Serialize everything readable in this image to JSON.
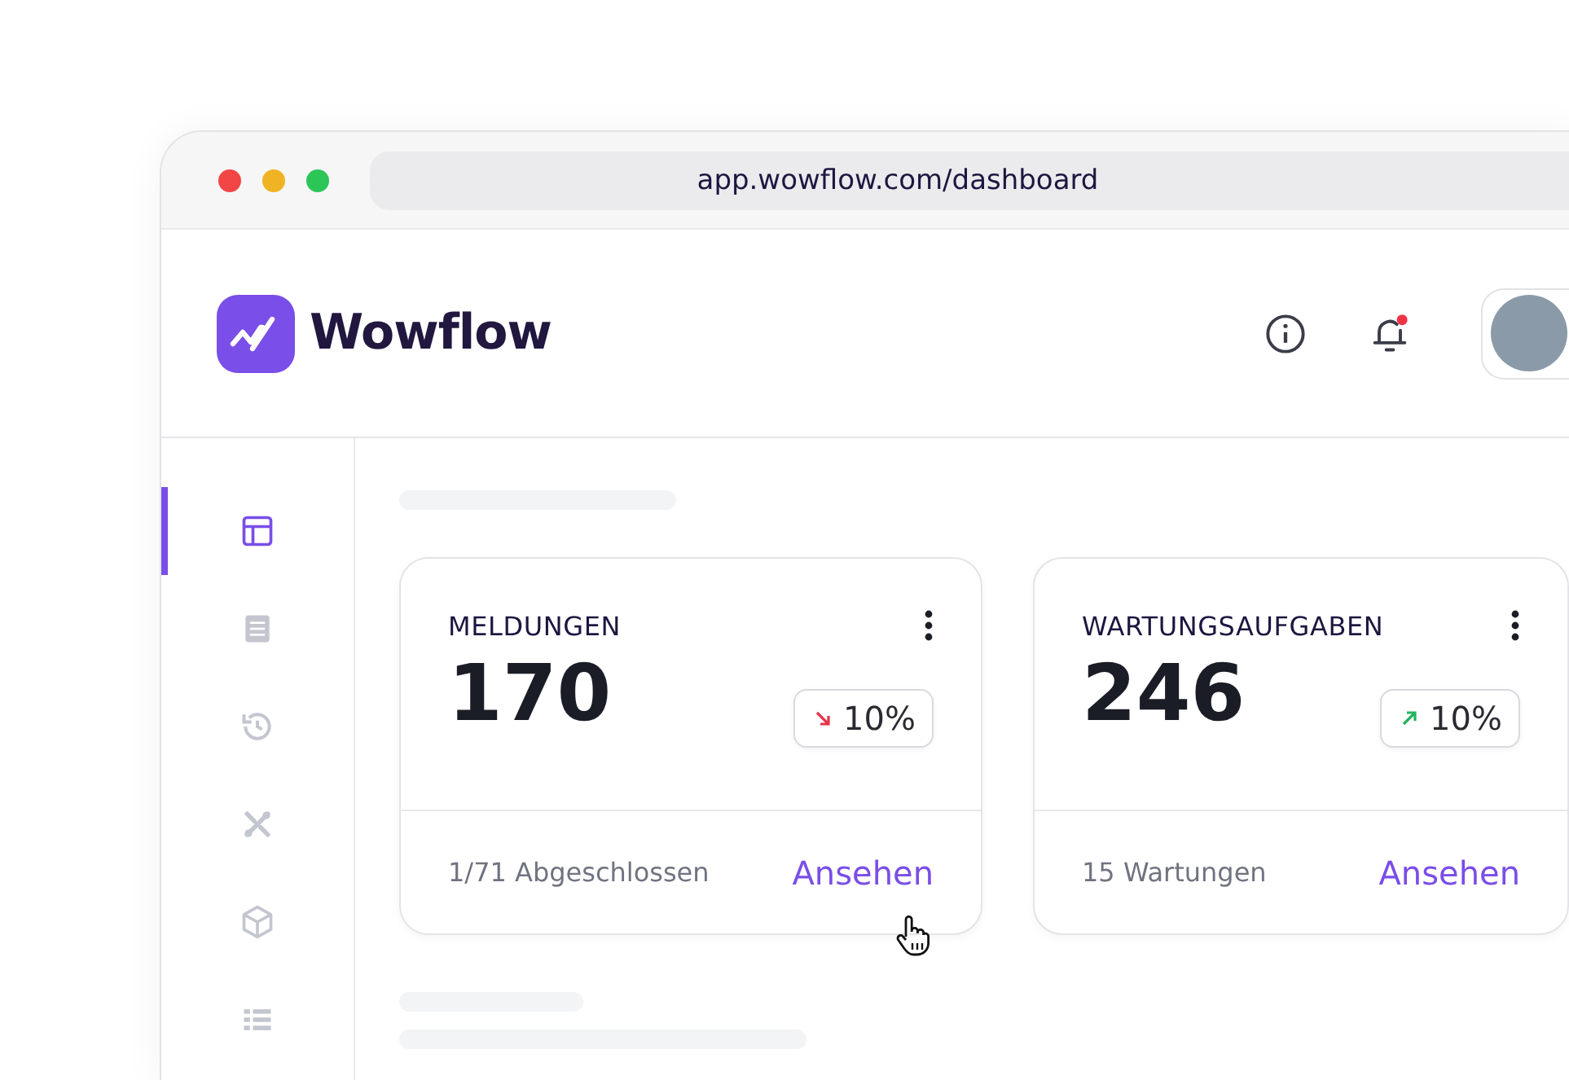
{
  "browser": {
    "url": "app.wowflow.com/dashboard"
  },
  "header": {
    "logo_text": "Wowflow",
    "notifications_unread": true
  },
  "sidebar": {
    "items": [
      {
        "kind": "layout",
        "selected": true
      },
      {
        "kind": "document",
        "selected": false
      },
      {
        "kind": "history",
        "selected": false
      },
      {
        "kind": "tools",
        "selected": false
      },
      {
        "kind": "box",
        "selected": false
      },
      {
        "kind": "list",
        "selected": false
      }
    ]
  },
  "cards": [
    {
      "title": "MELDUNGEN",
      "value": "170",
      "trend": {
        "rising": false,
        "text": "10%"
      },
      "footer": "1/71 Abgeschlossen",
      "link": "Ansehen"
    },
    {
      "title": "WARTUNGSAUFGABEN",
      "value": "246",
      "trend": {
        "rising": true,
        "text": "10%"
      },
      "footer": "15 Wartungen",
      "link": "Ansehen"
    }
  ]
}
